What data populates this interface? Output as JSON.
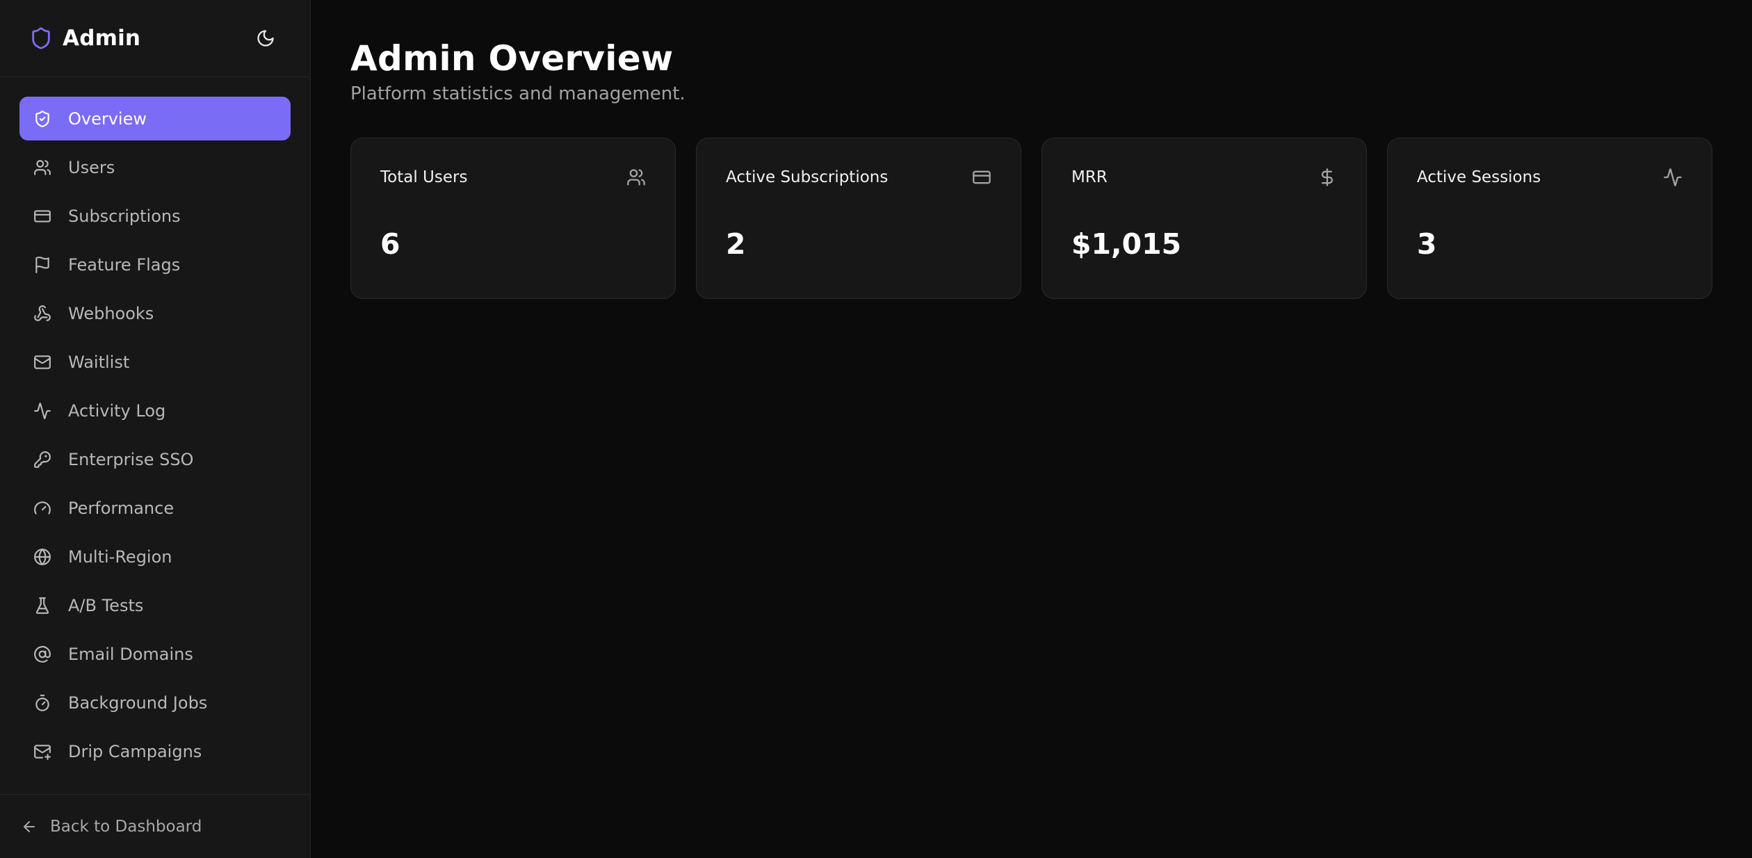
{
  "sidebar": {
    "brand": {
      "title": "Admin",
      "icon": "shield-icon",
      "accent": "#7b6cf6"
    },
    "theme_toggle": {
      "icon": "moon-icon"
    },
    "items": [
      {
        "label": "Overview",
        "icon": "shield-check-icon",
        "active": true
      },
      {
        "label": "Users",
        "icon": "users-icon"
      },
      {
        "label": "Subscriptions",
        "icon": "credit-card-icon"
      },
      {
        "label": "Feature Flags",
        "icon": "flag-icon"
      },
      {
        "label": "Webhooks",
        "icon": "webhook-icon"
      },
      {
        "label": "Waitlist",
        "icon": "mail-icon"
      },
      {
        "label": "Activity Log",
        "icon": "activity-icon"
      },
      {
        "label": "Enterprise SSO",
        "icon": "key-icon"
      },
      {
        "label": "Performance",
        "icon": "gauge-icon"
      },
      {
        "label": "Multi-Region",
        "icon": "globe-icon"
      },
      {
        "label": "A/B Tests",
        "icon": "flask-icon"
      },
      {
        "label": "Email Domains",
        "icon": "at-sign-icon"
      },
      {
        "label": "Background Jobs",
        "icon": "timer-icon"
      },
      {
        "label": "Drip Campaigns",
        "icon": "mail-plus-icon"
      }
    ],
    "footer": {
      "label": "Back to Dashboard",
      "icon": "arrow-left-icon"
    }
  },
  "main": {
    "title": "Admin Overview",
    "subtitle": "Platform statistics and management.",
    "cards": [
      {
        "title": "Total Users",
        "value": "6",
        "icon": "users-icon"
      },
      {
        "title": "Active Subscriptions",
        "value": "2",
        "icon": "credit-card-icon"
      },
      {
        "title": "MRR",
        "value": "$1,015",
        "icon": "dollar-sign-icon"
      },
      {
        "title": "Active Sessions",
        "value": "3",
        "icon": "activity-icon"
      }
    ]
  },
  "colors": {
    "background": "#0b0b0b",
    "sidebar": "#171717",
    "card": "#171717",
    "accent": "#7b6cf6",
    "text_muted": "#a3a3a3"
  }
}
